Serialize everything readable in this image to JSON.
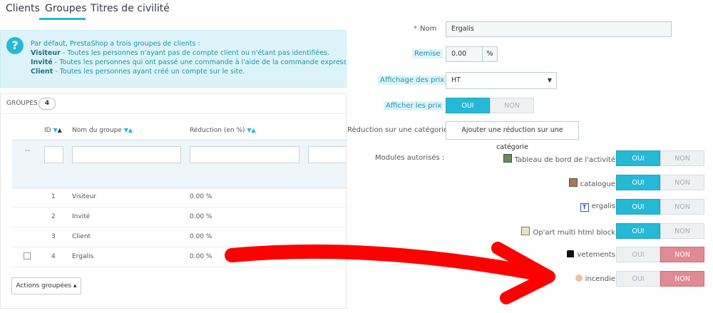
{
  "tabs": [
    {
      "label": "Clients"
    },
    {
      "label": "Groupes"
    },
    {
      "label": "Titres de civilité"
    }
  ],
  "info": {
    "intro": "Par défaut, PrestaShop a trois groupes de clients :",
    "lines": [
      {
        "key": "Visiteur",
        "text": " - Toutes les personnes n'ayant pas de compte client ou n'étant pas identifiées."
      },
      {
        "key": "Invité",
        "text": " - Toutes les personnes qui ont passé une commande à l'aide de la commande express (guest c"
      },
      {
        "key": "Client",
        "text": " - Toutes les personnes ayant créé un compte sur le site."
      }
    ]
  },
  "panel": {
    "title": "GROUPES",
    "count": "4",
    "headers": {
      "id": "ID",
      "name": "Nom du groupe",
      "reduction": "Réduction (en %)"
    },
    "filter_dash": "--",
    "rows": [
      {
        "id": "1",
        "name": "Visiteur",
        "reduction": "0.00 %"
      },
      {
        "id": "2",
        "name": "Invité",
        "reduction": "0.00 %"
      },
      {
        "id": "3",
        "name": "Client",
        "reduction": "0.00 %"
      },
      {
        "id": "4",
        "name": "Ergalis",
        "reduction": "0.00 %"
      }
    ],
    "bulk_label": "Actions groupées ▴"
  },
  "form": {
    "name_label": "Nom",
    "name_required": "*",
    "name_value": "Ergalis",
    "discount_label": "Remise",
    "discount_value": "0.00",
    "discount_unit": "%",
    "price_display_label": "Affichage des prix",
    "price_display_value": "HT",
    "show_prices_label": "Afficher les prix",
    "category_reduction_label": "Réduction sur une catégorie",
    "category_reduction_button": "Ajouter une réduction sur une catégorie",
    "modules_label": "Modules autorisés :",
    "on_label": "OUI",
    "off_label": "NON",
    "modules": [
      {
        "name": "Tableau de bord de l'activité",
        "icon": "dashboard-icon",
        "state": "on"
      },
      {
        "name": "catalogue",
        "icon": "catalog-icon",
        "state": "on"
      },
      {
        "name": "ergalis",
        "icon": "text-t-icon",
        "state": "on"
      },
      {
        "name": "Op'art multi html block",
        "icon": "html-block-icon",
        "state": "on"
      },
      {
        "name": "vetements",
        "icon": "tshirt-icon",
        "state": "off"
      },
      {
        "name": "incendie",
        "icon": "fire-hand-icon",
        "state": "off"
      }
    ]
  },
  "annotation": {
    "arrow_color": "#ff0000",
    "icon": "red-arrow-annotation"
  },
  "colors": {
    "accent": "#25b9d7",
    "off_red": "#e08b93"
  }
}
